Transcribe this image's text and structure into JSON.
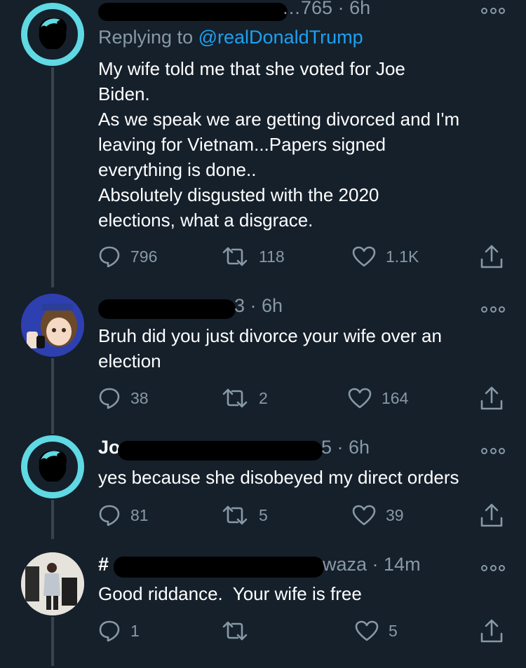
{
  "tweets": [
    {
      "handle_suffix": "…765",
      "time": "6h",
      "replying_prefix": "Replying to ",
      "replying_mention": "@realDonaldTrump",
      "body": "My wife told me that she voted for Joe\nBiden.\nAs we speak we are getting divorced and I'm\nleaving for Vietnam...Papers signed\neverything is done..\nAbsolutely disgusted with the 2020\nelections, what a disgrace.",
      "replies": "796",
      "retweets": "118",
      "likes": "1.1K"
    },
    {
      "handle_suffix": "3",
      "time": "6h",
      "body": "Bruh did you just divorce your wife over an\nelection",
      "replies": "38",
      "retweets": "2",
      "likes": "164"
    },
    {
      "name_prefix": "Jo",
      "handle_suffix": "5",
      "time": "6h",
      "body": "yes because she disobeyed my direct orders",
      "replies": "81",
      "retweets": "5",
      "likes": "39"
    },
    {
      "name_prefix": "#",
      "handle_suffix": "waza",
      "time": "14m",
      "body": "Good riddance.  Your wife is free",
      "replies": "1",
      "retweets": "",
      "likes": "5"
    }
  ],
  "icons": {
    "reply": "speech-bubble-icon",
    "retweet": "retweet-arrows-icon",
    "like": "heart-icon",
    "share": "share-upload-icon",
    "more": "three-dots-icon"
  },
  "colors": {
    "background": "#15202b",
    "muted": "#8899a6",
    "accent": "#1da1f2",
    "avatar_ring": "#5fd9e3",
    "thread_line": "#38444d"
  }
}
